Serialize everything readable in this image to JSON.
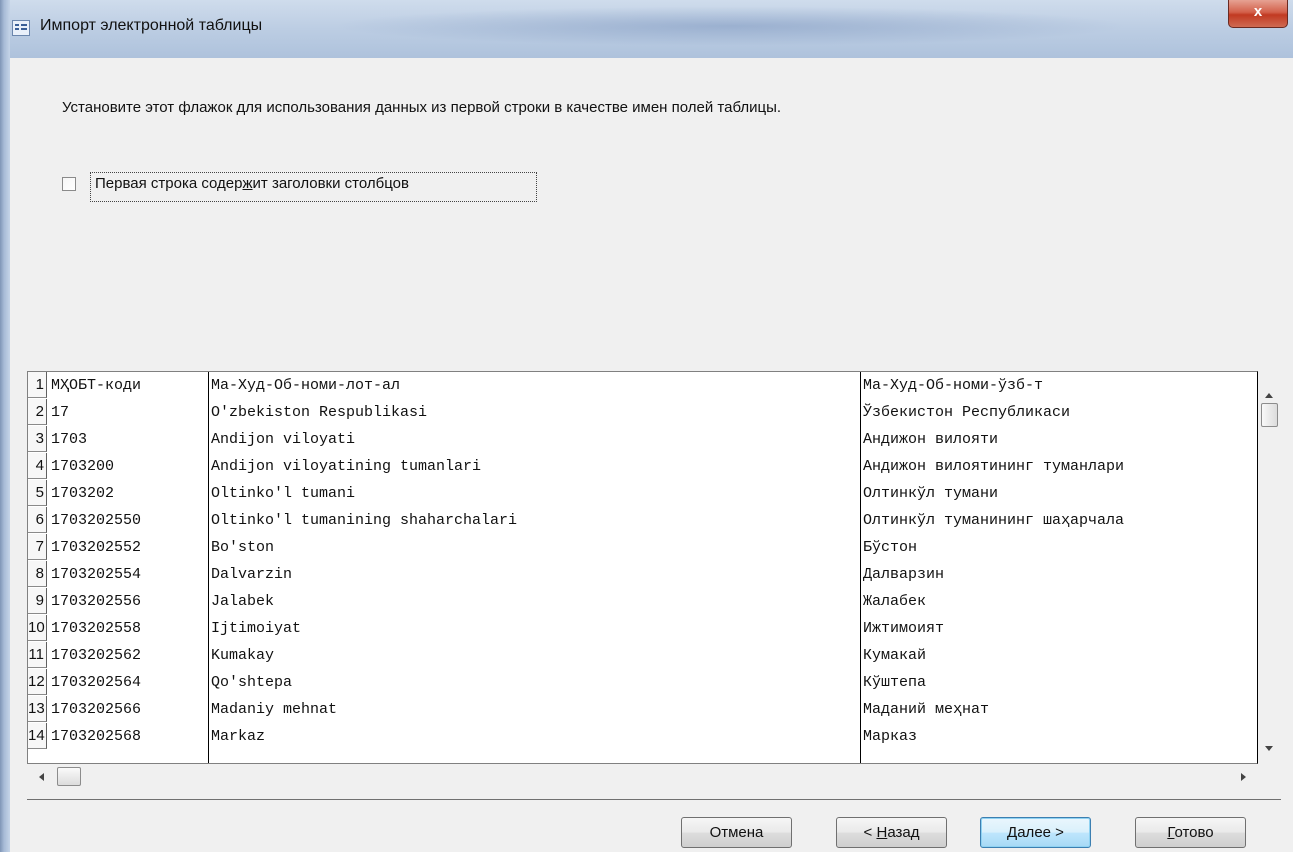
{
  "window": {
    "title": "Импорт электронной таблицы",
    "close_label": "x"
  },
  "instruction": "Установите этот флажок для использования данных из первой строки в качестве имен полей таблицы.",
  "checkbox": {
    "label_before": "Первая строка содер",
    "label_accel": "ж",
    "label_after": "ит заголовки столбцов",
    "checked": false
  },
  "table": {
    "rows": [
      {
        "num": "1",
        "c1": "МҲОБТ-коди",
        "c2": "Ма-Худ-Об-номи-лот-ал",
        "c3": "Ма-Худ-Об-номи-ўзб-т"
      },
      {
        "num": "2",
        "c1": "17",
        "c2": "O'zbekiston Respublikasi",
        "c3": "Ўзбекистон Республикаси"
      },
      {
        "num": "3",
        "c1": "1703",
        "c2": "Andijon viloyati",
        "c3": "Андижон вилояти"
      },
      {
        "num": "4",
        "c1": "1703200",
        "c2": "Andijon viloyatining tumanlari",
        "c3": "Андижон вилоятининг туманлари"
      },
      {
        "num": "5",
        "c1": "1703202",
        "c2": "Oltinko'l tumani",
        "c3": "Олтинкўл тумани"
      },
      {
        "num": "6",
        "c1": "1703202550",
        "c2": "Oltinko'l tumanining shaharchalari",
        "c3": "Олтинкўл туманининг шаҳарчала"
      },
      {
        "num": "7",
        "c1": "1703202552",
        "c2": "Bo'ston",
        "c3": "Бўстон"
      },
      {
        "num": "8",
        "c1": "1703202554",
        "c2": "Dalvarzin",
        "c3": "Далварзин"
      },
      {
        "num": "9",
        "c1": "1703202556",
        "c2": "Jalabek",
        "c3": "Жалабек"
      },
      {
        "num": "10",
        "c1": "1703202558",
        "c2": "Ijtimoiyat",
        "c3": "Ижтимоият"
      },
      {
        "num": "11",
        "c1": "1703202562",
        "c2": "Kumakay",
        "c3": "Кумакай"
      },
      {
        "num": "12",
        "c1": "1703202564",
        "c2": "Qo'shtepa",
        "c3": "Кўштепа"
      },
      {
        "num": "13",
        "c1": "1703202566",
        "c2": "Madaniy mehnat",
        "c3": "Маданий меҳнат"
      },
      {
        "num": "14",
        "c1": "1703202568",
        "c2": "Markaz",
        "c3": "Марказ"
      }
    ]
  },
  "buttons": {
    "cancel": {
      "label": "Отмена"
    },
    "back": {
      "prefix": "< ",
      "accel": "Н",
      "rest": "азад"
    },
    "next": {
      "accel": "Д",
      "rest": "алее >"
    },
    "finish": {
      "accel": "Г",
      "rest": "отово"
    }
  }
}
